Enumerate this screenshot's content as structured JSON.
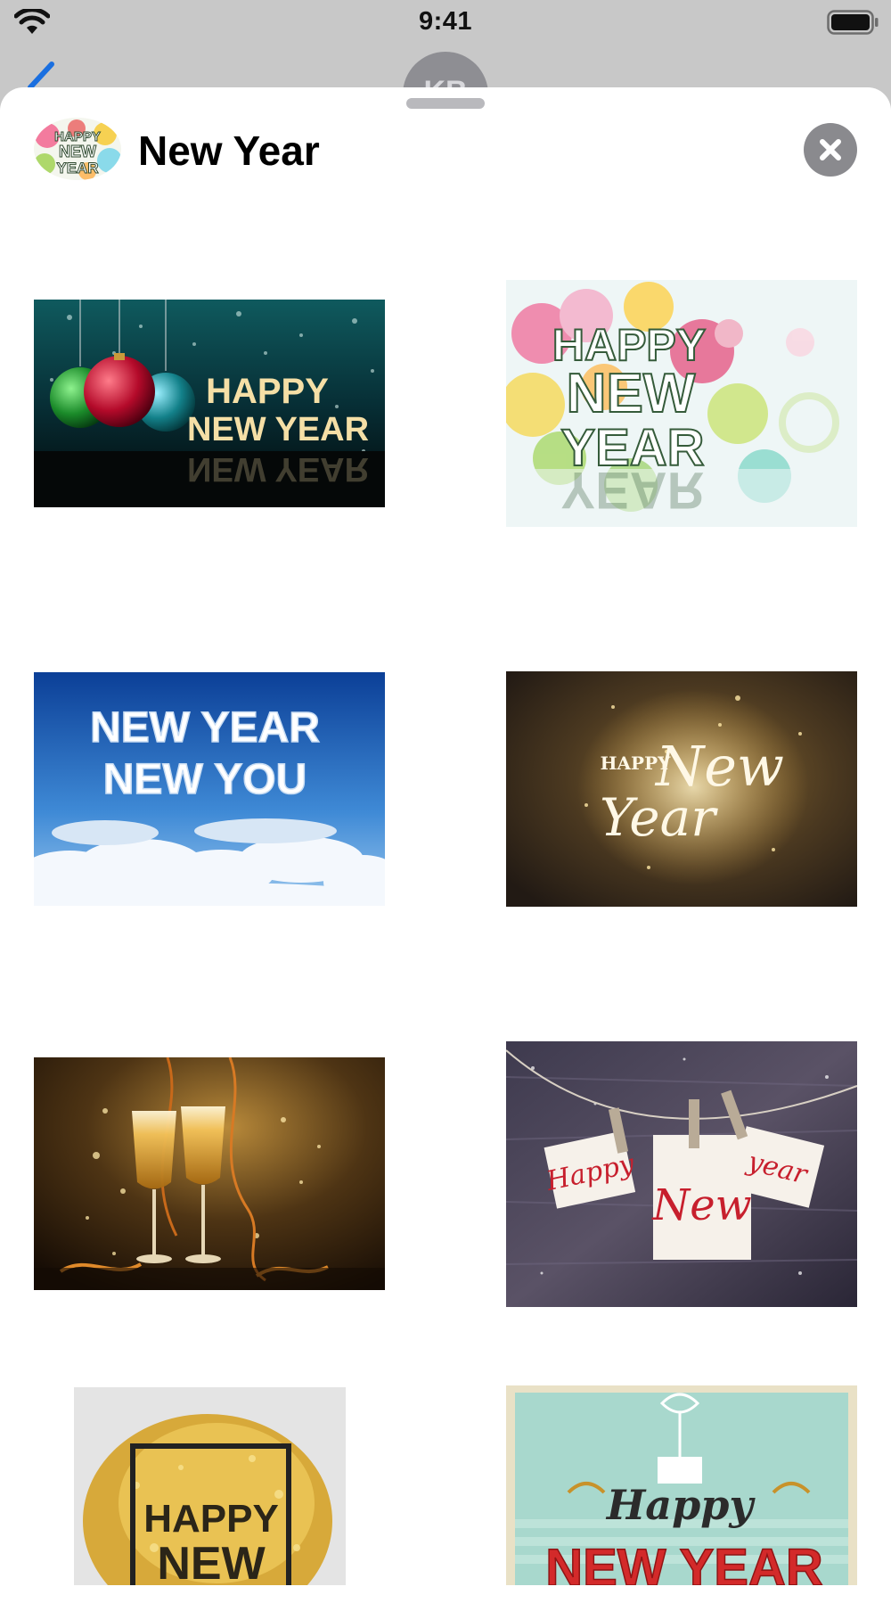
{
  "status_bar": {
    "time": "9:41",
    "wifi_icon": "wifi-icon",
    "battery_icon": "battery-icon"
  },
  "background": {
    "avatar_initials": "KB"
  },
  "sheet": {
    "title": "New Year",
    "app_icon": "new-year-app-icon",
    "close_icon": "close-icon"
  },
  "stickers": [
    {
      "id": "sticker-1",
      "text": [
        "HAPPY",
        "NEW YEAR"
      ]
    },
    {
      "id": "sticker-2",
      "text": [
        "HAPPY",
        "NEW",
        "YEAR"
      ]
    },
    {
      "id": "sticker-3",
      "text": [
        "NEW YEAR",
        "NEW YOU"
      ]
    },
    {
      "id": "sticker-4",
      "text": [
        "HAPPY",
        "New",
        "Year"
      ]
    },
    {
      "id": "sticker-5",
      "text": []
    },
    {
      "id": "sticker-6",
      "text": [
        "Happy",
        "New",
        "year"
      ]
    },
    {
      "id": "sticker-7",
      "text": [
        "HAPPY",
        "NEW"
      ]
    },
    {
      "id": "sticker-8",
      "text": [
        "Happy",
        "NEW YEAR"
      ]
    }
  ],
  "colors": {
    "accent": "#1a6fe0",
    "sheet_bg": "#ffffff",
    "close_button": "#8a8a8e"
  }
}
